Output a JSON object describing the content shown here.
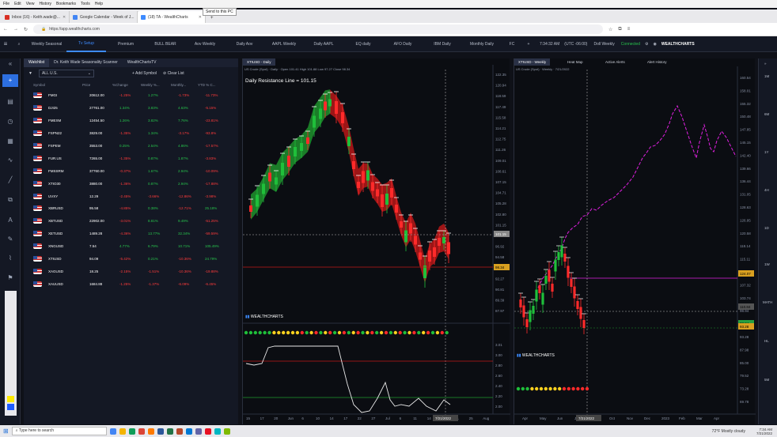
{
  "browser": {
    "menu": [
      "File",
      "Edit",
      "View",
      "History",
      "Bookmarks",
      "Tools",
      "Help"
    ],
    "tooltip": "Send to this PC",
    "tabs": [
      {
        "label": "Inbox (16) - Keith.wade@..."
      },
      {
        "label": "Google Calendar - Week of J..."
      },
      {
        "label": "(18) TA - WealthCharts"
      }
    ],
    "url": "https://app.wealthcharts.com"
  },
  "header": {
    "tabs": [
      "Weekly Seasonal",
      "Tv Setup",
      "Premium",
      "BULL BEAR",
      "Aov Weekly",
      "Daily Aov",
      "AAPL Weekly",
      "Daily AAPL",
      "EQ daily",
      "AFO Daily",
      "IBM Daily",
      "Monthly Daily",
      "FC"
    ],
    "active_tab": 1,
    "time": "7:34:32 AM",
    "timezone": "(UTC -06:00)",
    "account": "Doll Weekly",
    "status": "Connected",
    "brand": "WEALTHCHARTS"
  },
  "watchlist": {
    "tabs": [
      "Watchlist",
      "Dr. Keith Wade Seasonality Scanner",
      "WealthChartsTV"
    ],
    "selector": "ALL U.S.",
    "add_symbol": "Add Symbol",
    "clear_list": "Clear List",
    "columns": [
      "Symbol",
      "Price",
      "%Change",
      "Weekly %...",
      "Monthly...",
      "YTD % C..."
    ],
    "rows": [
      {
        "symbol": "FMGI",
        "price": "20612.00",
        "chg": "-1.25%",
        "wk": "1.27%",
        "mo": "-1.73%",
        "ytd": "-11.73%"
      },
      {
        "symbol": "DJI25",
        "price": "27761.00",
        "chg": "1.34%",
        "wk": "3.83%",
        "mo": "4.63%",
        "ytd": "-5.15%"
      },
      {
        "symbol": "FMEXM",
        "price": "12454.50",
        "chg": "1.26%",
        "wk": "3.82%",
        "mo": "7.76%",
        "ytd": "-23.81%"
      },
      {
        "symbol": "FSPN22",
        "price": "3829.00",
        "chg": "-1.35%",
        "wk": "1.34%",
        "mo": "-3.17%",
        "ytd": "-93.8%"
      },
      {
        "symbol": "FSPEM",
        "price": "3553.00",
        "chg": "0.25%",
        "wk": "2.54%",
        "mo": "4.86%",
        "ytd": "-17.57%"
      },
      {
        "symbol": "FUR.US",
        "price": "7265.00",
        "chg": "-1.35%",
        "wk": "0.87%",
        "mo": "1.87%",
        "ytd": "-3.83%"
      },
      {
        "symbol": "FMSSRM",
        "price": "37760.00",
        "chg": "-0.37%",
        "wk": "1.67%",
        "mo": "2.94%",
        "ytd": "-10.09%"
      },
      {
        "symbol": "XTIO30",
        "price": "3880.00",
        "chg": "-1.36%",
        "wk": "0.87%",
        "mo": "2.94%",
        "ytd": "-17.88%"
      },
      {
        "symbol": "UVXY",
        "price": "12.29",
        "chg": "-2.45%",
        "wk": "-3.66%",
        "mo": "-12.86%",
        "ytd": "-3.98%"
      },
      {
        "symbol": "XBRUSD",
        "price": "95.58",
        "chg": "-4.85%",
        "wk": "0.38%",
        "mo": "-12.71%",
        "ytd": "25.18%"
      },
      {
        "symbol": "XBTUSD",
        "price": "22902.00",
        "chg": "-3.01%",
        "wk": "8.81%",
        "mo": "9.49%",
        "ytd": "-51.25%"
      },
      {
        "symbol": "XETUSD",
        "price": "1489.28",
        "chg": "-4.36%",
        "wk": "13.77%",
        "mo": "32.34%",
        "ytd": "-59.59%"
      },
      {
        "symbol": "XNGUSD",
        "price": "7.54",
        "chg": "4.77%",
        "wk": "6.79%",
        "mo": "10.71%",
        "ytd": "105.49%"
      },
      {
        "symbol": "XTIUSD",
        "price": "94.09",
        "chg": "-5.42%",
        "wk": "0.21%",
        "mo": "-10.36%",
        "ytd": "24.79%"
      },
      {
        "symbol": "XAGUSD",
        "price": "18.25",
        "chg": "-2.15%",
        "wk": "-1.51%",
        "mo": "-10.36%",
        "ytd": "-19.88%"
      },
      {
        "symbol": "XAUUSD",
        "price": "1684.88",
        "chg": "-1.25%",
        "wk": "-1.37%",
        "mo": "-6.09%",
        "ytd": "-6.45%"
      }
    ]
  },
  "chartA": {
    "tab": "XTIUSD - Daily",
    "sub": "US Crude (Spot) · Daily · Open 101.41 High 101.88 Low 97.27 Close 98.34",
    "annotation": "Daily Resistance Line = 101.15",
    "brand": "WEALTHCHARTS",
    "yticks": [
      "122.35",
      "120.94",
      "118.59",
      "117.49",
      "115.58",
      "114.21",
      "112.75",
      "111.26",
      "109.01",
      "108.61",
      "107.15",
      "104.71",
      "105.28",
      "102.80",
      "101.15",
      "99.35",
      "96.92",
      "94.58",
      "93.23",
      "92.27",
      "90.81",
      "89.39",
      "87.97"
    ],
    "price_tag": "98.34",
    "level_tag": "101.15",
    "osc_ticks": [
      "3.01",
      "3.00",
      "2.80",
      "2.60",
      "2.40",
      "2.20",
      "2.00"
    ],
    "xticks": [
      "15",
      "17",
      "20",
      "Jun",
      "6",
      "10",
      "14",
      "17",
      "22",
      "27",
      "Jul",
      "6",
      "11",
      "14",
      "18",
      "21",
      "25",
      "Aug"
    ],
    "date_tag": "7/21/2022"
  },
  "chartB": {
    "tabs": [
      "XTIUSD - Weekly",
      "Heat Map",
      "Active Alerts",
      "Alert History"
    ],
    "sub": "US Crude (Spot) · Weekly · 7/21/2022",
    "brand": "WEALTHCHARTS",
    "yticks": [
      "160.54",
      "158.01",
      "155.32",
      "150.48",
      "147.85",
      "145.15",
      "142.40",
      "139.66",
      "136.44",
      "131.05",
      "128.63",
      "126.95",
      "120.58",
      "118.14",
      "115.11",
      "112.68",
      "107.32",
      "103.74",
      "98.94",
      "95.64",
      "93.28",
      "87.98",
      "85.00",
      "79.52",
      "73.28",
      "69.78"
    ],
    "tags": [
      "124.07",
      "110.84",
      "98.94",
      "93.28"
    ],
    "xticks": [
      "Apr",
      "May",
      "Jun",
      "Jul",
      "Sep",
      "Oct",
      "Nov",
      "Dec",
      "2023",
      "Feb",
      "Mar",
      "Apr"
    ],
    "date_tag": "7/21/2022"
  },
  "rightbar": [
    "1M",
    "6M",
    "1Y",
    "4H",
    "1D",
    "1W",
    "MATH",
    "HL",
    "5M"
  ],
  "taskbar": {
    "search": "Type here to search",
    "weather": "72°F Mostly cloudy",
    "time": "7:34 AM",
    "date": "7/21/2022"
  },
  "colors": {
    "up": "#1f9a2e",
    "down": "#e01f1f",
    "accent": "#3d8bff",
    "magenta": "#e020e0"
  }
}
